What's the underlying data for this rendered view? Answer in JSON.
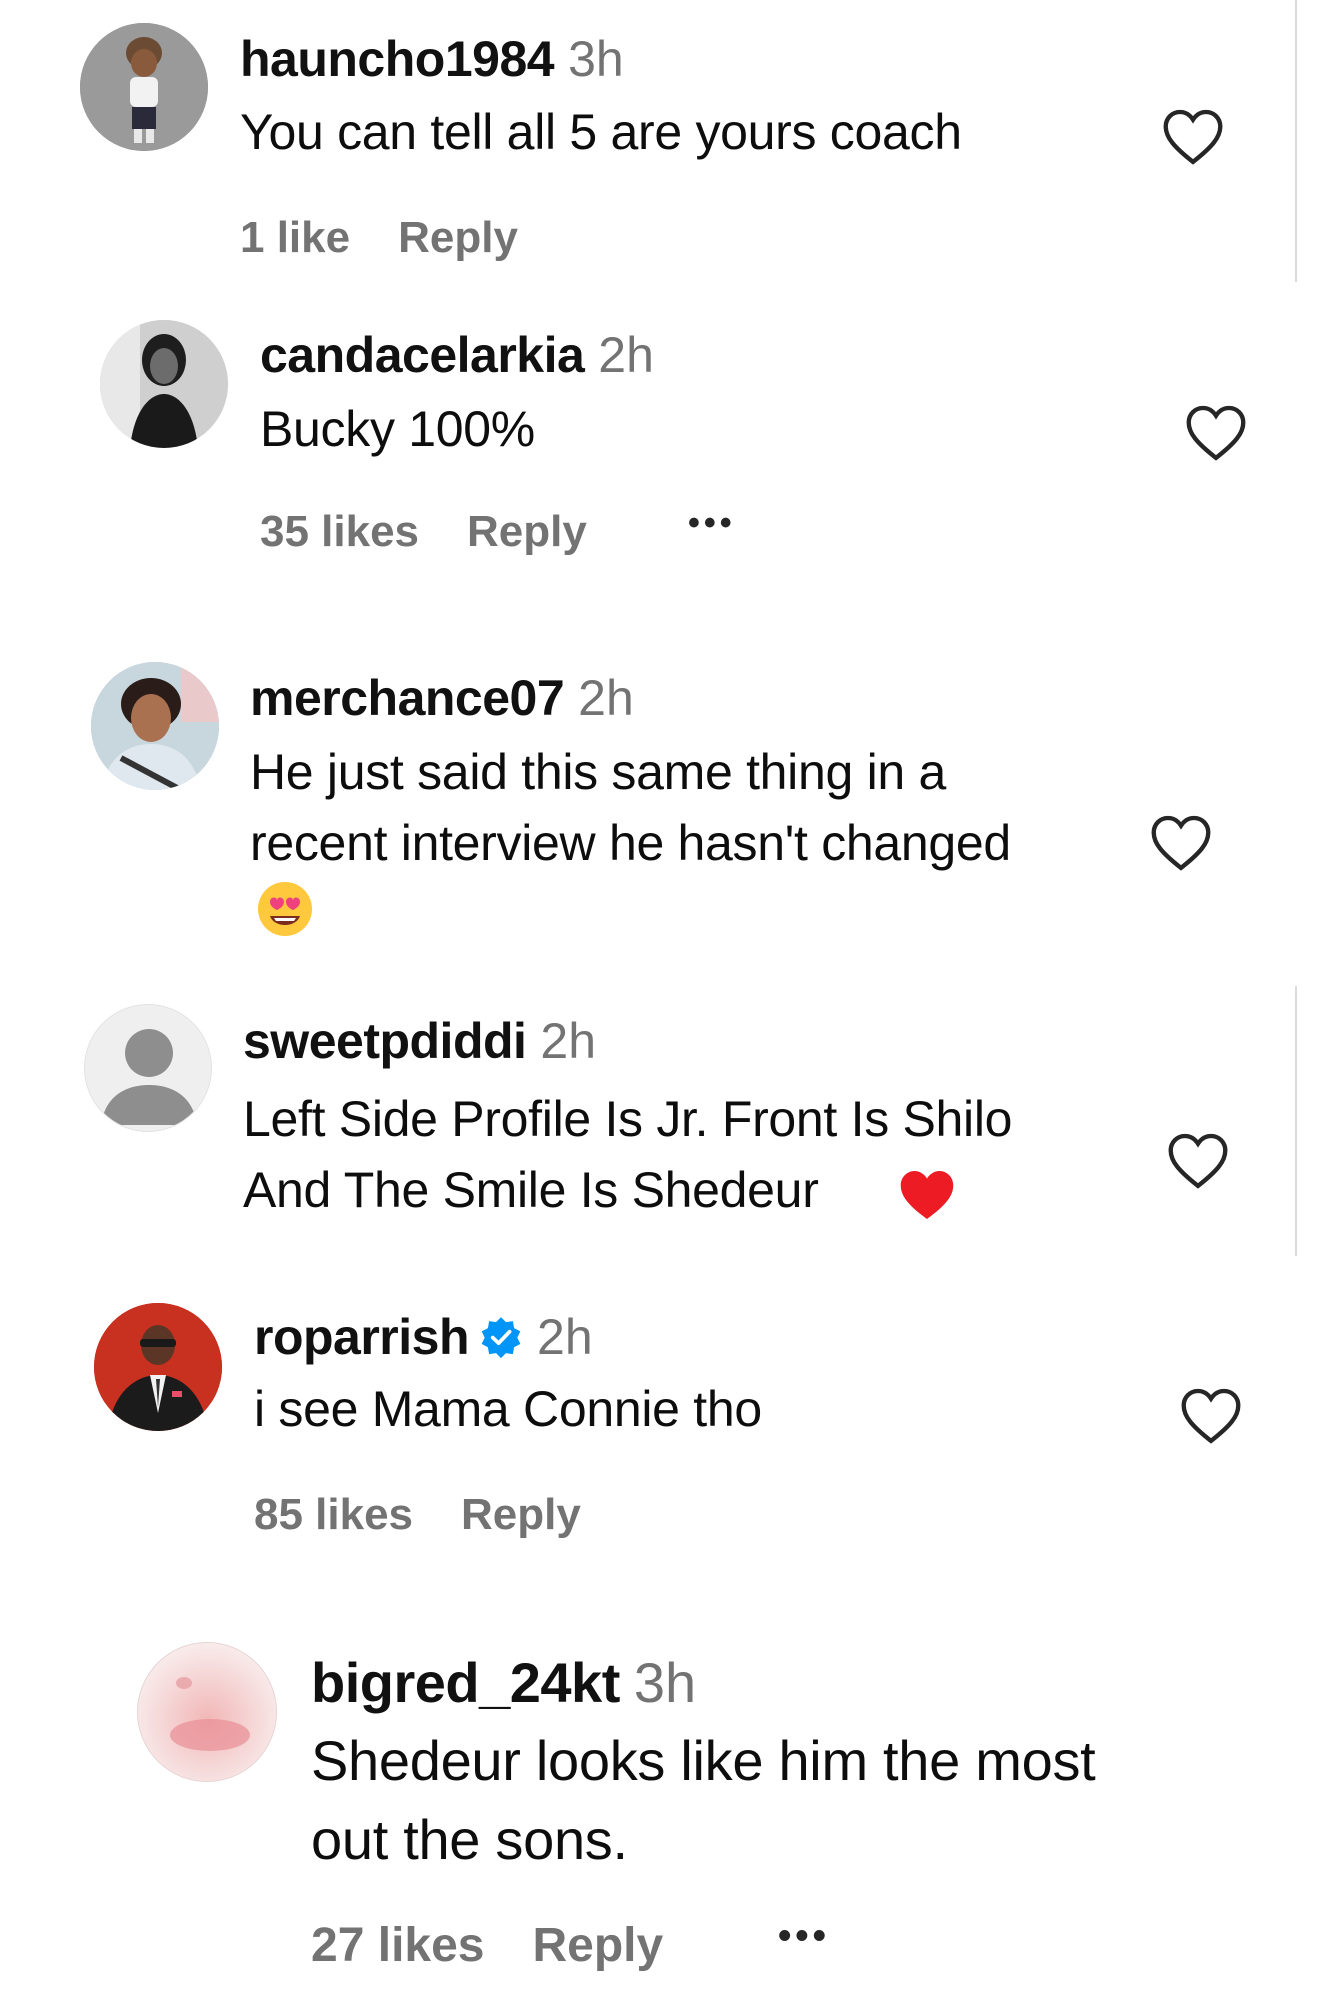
{
  "colors": {
    "secondary_text": "#737373",
    "verified_blue": "#0095f6",
    "heart_red": "#ed1c24"
  },
  "comments": [
    {
      "username": "hauncho1984",
      "time": "3h",
      "text": "You can tell all 5 are yours coach",
      "likes": "1 like",
      "reply": "Reply",
      "avatar": "cartoon-child-avatar"
    },
    {
      "username": "candacelarkia",
      "time": "2h",
      "text": "Bucky 100%",
      "likes": "35 likes",
      "reply": "Reply",
      "more": "•••",
      "avatar": "bw-photo-avatar"
    },
    {
      "username": "merchance07",
      "time": "2h",
      "text_line1": "He just said this same thing in a",
      "text_line2": "recent interview he hasn't changed",
      "emoji": "heart-eyes-emoji",
      "avatar": "selfie-avatar"
    },
    {
      "username": "sweetpdiddi",
      "time": "2h",
      "text_line1": "Left Side Profile Is Jr. Front Is Shilo",
      "text_line2": "And The Smile Is Shedeur",
      "emoji": "red-heart-emoji",
      "avatar": "default-user-avatar"
    },
    {
      "username": "roparrish",
      "time": "2h",
      "text": "i see Mama Connie tho",
      "likes": "85 likes",
      "reply": "Reply",
      "verified": true,
      "avatar": "suit-portrait-avatar"
    },
    {
      "username": "bigred_24kt",
      "time": "3h",
      "text_line1": "Shedeur looks like him the most",
      "text_line2": "out the sons.",
      "likes": "27 likes",
      "reply": "Reply",
      "more": "•••",
      "avatar": "pink-blur-avatar"
    }
  ]
}
